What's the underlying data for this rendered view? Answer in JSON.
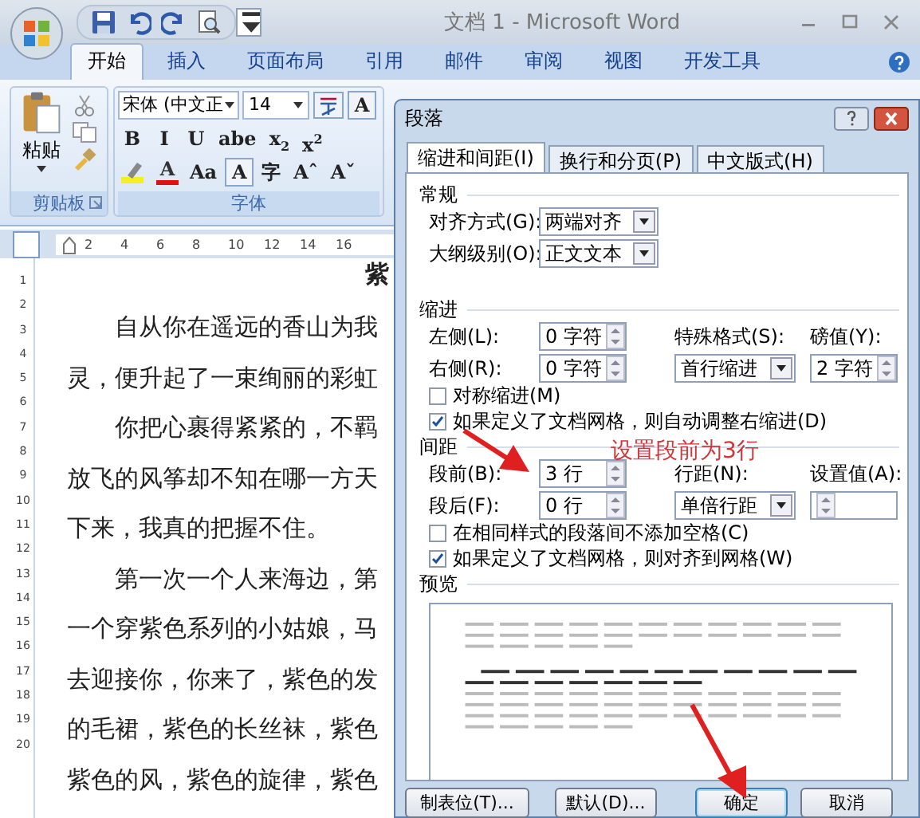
{
  "window": {
    "title": "文档 1 - Microsoft Word"
  },
  "ribbon_tabs": [
    {
      "label": "开始",
      "selected": true
    },
    {
      "label": "插入",
      "selected": false
    },
    {
      "label": "页面布局",
      "selected": false
    },
    {
      "label": "引用",
      "selected": false
    },
    {
      "label": "邮件",
      "selected": false
    },
    {
      "label": "审阅",
      "selected": false
    },
    {
      "label": "视图",
      "selected": false
    },
    {
      "label": "开发工具",
      "selected": false
    }
  ],
  "clipboard": {
    "paste_label": "粘贴",
    "group_label": "剪贴板"
  },
  "font_group": {
    "font_name": "宋体 (中文正",
    "font_size": "14",
    "row1": [
      "A"
    ],
    "row2": [
      "B",
      "I",
      "U",
      "abe",
      "x$_{2}$",
      "x$^{2}$"
    ],
    "row3": [
      "Aa",
      "A",
      "字",
      "Aˆ",
      "Aˇ"
    ],
    "font_color_label": "A",
    "group_label": "字体"
  },
  "ruler": {
    "ticks": [
      "2",
      "4",
      "6",
      "8",
      "10",
      "12",
      "14",
      "16"
    ],
    "vertical_ticks": [
      "1",
      "2",
      "3",
      "4",
      "5",
      "6",
      "7",
      "8",
      "9",
      "10",
      "11",
      "12",
      "13",
      "14",
      "15",
      "16",
      "17",
      "18",
      "19",
      "20"
    ]
  },
  "document": {
    "heading": "紫",
    "lines": [
      {
        "text": "自从你在遥远的香山为我",
        "indent": true
      },
      {
        "text": "灵，便升起了一束绚丽的彩虹",
        "indent": false
      },
      {
        "text": "你把心裹得紧紧的，不羁",
        "indent": true
      },
      {
        "text": "放飞的风筝却不知在哪一方天",
        "indent": false
      },
      {
        "text": "下来，我真的把握不住。",
        "indent": false
      },
      {
        "text": "第一次一个人来海边，第",
        "indent": true
      },
      {
        "text": "一个穿紫色系列的小姑娘，马",
        "indent": false
      },
      {
        "text": "去迎接你，你来了，紫色的发",
        "indent": false
      },
      {
        "text": "的毛裙，紫色的长丝袜，紫色",
        "indent": false
      },
      {
        "text": "紫色的风，紫色的旋律，紫色",
        "indent": false
      }
    ]
  },
  "dialog": {
    "title": "段落",
    "tabs": [
      {
        "label": "缩进和间距(I)",
        "selected": true
      },
      {
        "label": "换行和分页(P)",
        "selected": false
      },
      {
        "label": "中文版式(H)",
        "selected": false
      }
    ],
    "general": {
      "heading": "常规",
      "fields": [
        {
          "label": "对齐方式(G):",
          "value": "两端对齐"
        },
        {
          "label": "大纲级别(O):",
          "value": "正文文本"
        }
      ]
    },
    "indent": {
      "heading": "缩进",
      "left": {
        "label": "左侧(L):",
        "value": "0 字符"
      },
      "right": {
        "label": "右侧(R):",
        "value": "0 字符"
      },
      "special": {
        "label": "特殊格式(S):",
        "value": "首行缩进"
      },
      "by": {
        "label": "磅值(Y):",
        "value": "2 字符"
      },
      "checkboxes": [
        {
          "label": "对称缩进(M)",
          "checked": false
        },
        {
          "label": "如果定义了文档网格，则自动调整右缩进(D)",
          "checked": true
        }
      ]
    },
    "spacing": {
      "heading": "间距",
      "before": {
        "label": "段前(B):",
        "value": "3 行"
      },
      "after": {
        "label": "段后(F):",
        "value": "0 行"
      },
      "line_spacing": {
        "label": "行距(N):",
        "value": "单倍行距"
      },
      "at": {
        "label": "设置值(A):"
      },
      "checkboxes": [
        {
          "label": "在相同样式的段落间不添加空格(C)",
          "checked": false
        },
        {
          "label": "如果定义了文档网格，则对齐到网格(W)",
          "checked": true
        }
      ]
    },
    "preview": {
      "heading": "预览"
    },
    "buttons": [
      {
        "label": "制表位(T)...",
        "default": false
      },
      {
        "label": "默认(D)...",
        "default": false
      },
      {
        "label": "确定",
        "default": true
      },
      {
        "label": "取消",
        "default": false
      }
    ]
  },
  "annotation": {
    "text": "设置段前为3行"
  }
}
